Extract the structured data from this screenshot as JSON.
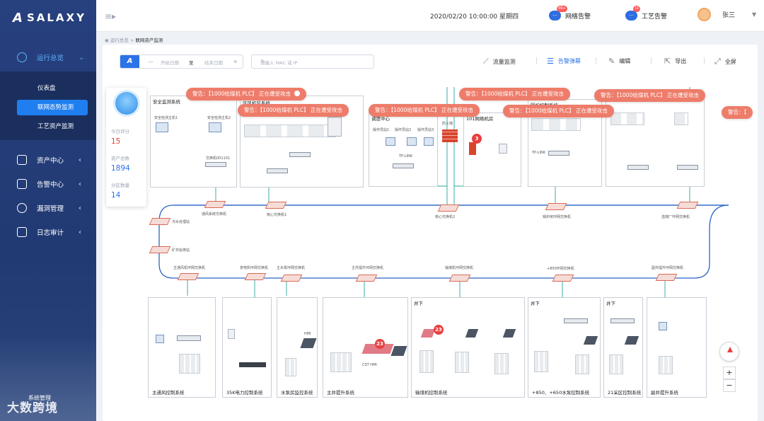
{
  "app": {
    "logo_mark": "A",
    "logo_text": "SALAXY"
  },
  "sidebar": {
    "items": [
      {
        "label": "运行总览",
        "icon": "dashboard-icon"
      },
      {
        "label": "资产中心",
        "icon": "asset-icon"
      },
      {
        "label": "告警中心",
        "icon": "alarm-icon"
      },
      {
        "label": "漏洞管理",
        "icon": "vulnerability-icon"
      },
      {
        "label": "日志审计",
        "icon": "log-icon"
      }
    ],
    "submenu": [
      "仪表盘",
      "联网态势监测",
      "工艺资产监测"
    ],
    "system": "系统管理",
    "watermark": "大数跨境"
  },
  "header": {
    "datetime": "2020/02/20 10:00:00  星期四",
    "net_alert": {
      "label": "网络告警",
      "badge": "99+"
    },
    "proc_alert": {
      "label": "工艺告警",
      "badge": "10"
    },
    "user": "张三"
  },
  "breadcrumb": {
    "parent": "运行总览",
    "sep": " > ",
    "current": "联网资产监测"
  },
  "toolbar": {
    "date_start": "开始日期",
    "date_sep": "至",
    "date_end": "结束日期",
    "search_placeholder": "请输入 MAC 或 IP",
    "tools": [
      "流量监测",
      "告警弹幕",
      "编辑",
      "导出",
      "全屏"
    ]
  },
  "stats": [
    {
      "label": "今日评分",
      "value": "15"
    },
    {
      "label": "资产总数",
      "value": "1894"
    },
    {
      "label": "分区数量",
      "value": "14"
    }
  ],
  "warnings": [
    "警告：【1000给煤机 PLC】 正在遭受攻击",
    "警告：【1000给煤机 PLC】 正在遭受攻击",
    "警告：【1000给煤机 PLC】 正在遭受攻击",
    "警告：【1000给煤机 PLC】 正在遭受攻击",
    "警告：【1000给煤机 PLC】 正在遭受攻击",
    "警告：【1000给煤机 PLC】 正在遭受攻击",
    "警告：【"
  ],
  "top_zones": {
    "security": "安全监测系统",
    "zone2": "压风机监系统",
    "dispatch": "调度中心",
    "room101": "101网络机房",
    "pump": "锅炉控制系统"
  },
  "bottom_zones": [
    "主通风控制系统",
    "35K电力控制系统",
    "水泵房监控系统",
    "主井提升系统",
    "输煤机控制系统",
    "+850、+650水泵控制系统",
    "21采区控制系统",
    "副井提升系统"
  ],
  "well_labels": [
    "井下",
    "井下",
    "井下"
  ],
  "ring_labels": [
    "通风系统交换机",
    "核心交换机1",
    "核心交换机2",
    "锅炉房环网交换机",
    "选煤厂环网交换机",
    "污水处理站",
    "矿井给排站",
    "主通风机环网交换机",
    "变电所环网交换机",
    "主水泵环网交换机",
    "主井提升环网交换机",
    "输煤机环网交换机",
    "+850环网交换机",
    "副井提升环网交换机"
  ],
  "misc_labels": {
    "s1": "安全检测主机1",
    "s2": "安全检测主机2",
    "sw1": "交换机001101",
    "fw": "防火墙",
    "tplink": "TP-LINK",
    "op1": "操作员站1",
    "op2": "操作员站2",
    "op3": "操作员站3",
    "hmi": "HMI",
    "cst": "CST HMI"
  },
  "pins": [
    "3",
    "23",
    "23"
  ],
  "zoom": {
    "in": "+",
    "out": "−"
  },
  "colors": {
    "accent": "#2d73e8",
    "warning": "#ee7c6a",
    "danger": "#e84040",
    "sidebar": "#223a73"
  }
}
